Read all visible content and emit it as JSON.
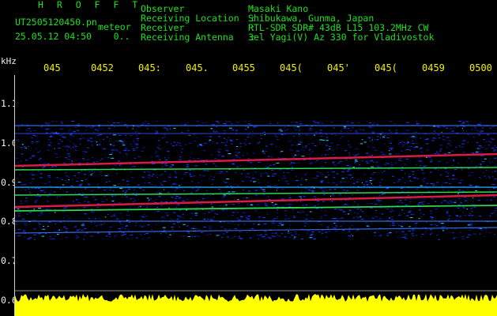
{
  "header": {
    "title": "H R O F F T",
    "file_name": "UT2505120450.pn",
    "file_tag": "meteor",
    "date_time": "25.05.12 04:50    0..",
    "info_labels": "Observer            :\nReceiving Location  :\nReceiver            :\nReceiving Antenna   :",
    "info_values": "Masaki Kano\nShibukawa, Gunma, Japan\nRTL-SDR SDR# 43dB L15 103.2MHz CW\n3el Yagi(V) Az 330 for Vladivostok"
  },
  "axis": {
    "unit": "kHz",
    "time_ticks": [
      "045",
      "0452",
      "045:",
      "045.",
      "0455",
      "045(",
      "045'",
      "045(",
      "0459",
      "0500"
    ],
    "freq_ticks": [
      "1.1",
      "1.0",
      "0.9",
      "0.8",
      "0.7",
      "0.6"
    ]
  },
  "colors": {
    "header_text": "#1fe01f",
    "info_text": "#f2f2f2",
    "time_text": "#f0f000",
    "signal_peak": "#ff2050",
    "signal_mid": "#30ff60",
    "noise": "#1a3cff",
    "amplitude": "#ffff00"
  }
}
